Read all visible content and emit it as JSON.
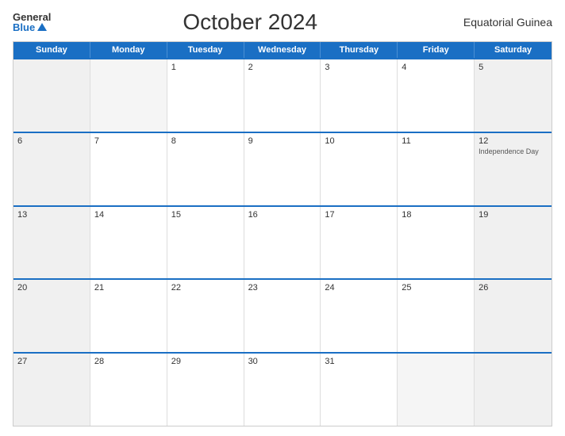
{
  "header": {
    "logo_general": "General",
    "logo_blue": "Blue",
    "title": "October 2024",
    "country": "Equatorial Guinea"
  },
  "weekdays": [
    "Sunday",
    "Monday",
    "Tuesday",
    "Wednesday",
    "Thursday",
    "Friday",
    "Saturday"
  ],
  "weeks": [
    [
      {
        "num": "",
        "empty": true,
        "event": ""
      },
      {
        "num": "",
        "empty": true,
        "event": ""
      },
      {
        "num": "1",
        "empty": false,
        "event": ""
      },
      {
        "num": "2",
        "empty": false,
        "event": ""
      },
      {
        "num": "3",
        "empty": false,
        "event": ""
      },
      {
        "num": "4",
        "empty": false,
        "event": ""
      },
      {
        "num": "5",
        "empty": false,
        "event": ""
      }
    ],
    [
      {
        "num": "6",
        "empty": false,
        "event": ""
      },
      {
        "num": "7",
        "empty": false,
        "event": ""
      },
      {
        "num": "8",
        "empty": false,
        "event": ""
      },
      {
        "num": "9",
        "empty": false,
        "event": ""
      },
      {
        "num": "10",
        "empty": false,
        "event": ""
      },
      {
        "num": "11",
        "empty": false,
        "event": ""
      },
      {
        "num": "12",
        "empty": false,
        "event": "Independence Day"
      }
    ],
    [
      {
        "num": "13",
        "empty": false,
        "event": ""
      },
      {
        "num": "14",
        "empty": false,
        "event": ""
      },
      {
        "num": "15",
        "empty": false,
        "event": ""
      },
      {
        "num": "16",
        "empty": false,
        "event": ""
      },
      {
        "num": "17",
        "empty": false,
        "event": ""
      },
      {
        "num": "18",
        "empty": false,
        "event": ""
      },
      {
        "num": "19",
        "empty": false,
        "event": ""
      }
    ],
    [
      {
        "num": "20",
        "empty": false,
        "event": ""
      },
      {
        "num": "21",
        "empty": false,
        "event": ""
      },
      {
        "num": "22",
        "empty": false,
        "event": ""
      },
      {
        "num": "23",
        "empty": false,
        "event": ""
      },
      {
        "num": "24",
        "empty": false,
        "event": ""
      },
      {
        "num": "25",
        "empty": false,
        "event": ""
      },
      {
        "num": "26",
        "empty": false,
        "event": ""
      }
    ],
    [
      {
        "num": "27",
        "empty": false,
        "event": ""
      },
      {
        "num": "28",
        "empty": false,
        "event": ""
      },
      {
        "num": "29",
        "empty": false,
        "event": ""
      },
      {
        "num": "30",
        "empty": false,
        "event": ""
      },
      {
        "num": "31",
        "empty": false,
        "event": ""
      },
      {
        "num": "",
        "empty": true,
        "event": ""
      },
      {
        "num": "",
        "empty": true,
        "event": ""
      }
    ]
  ]
}
